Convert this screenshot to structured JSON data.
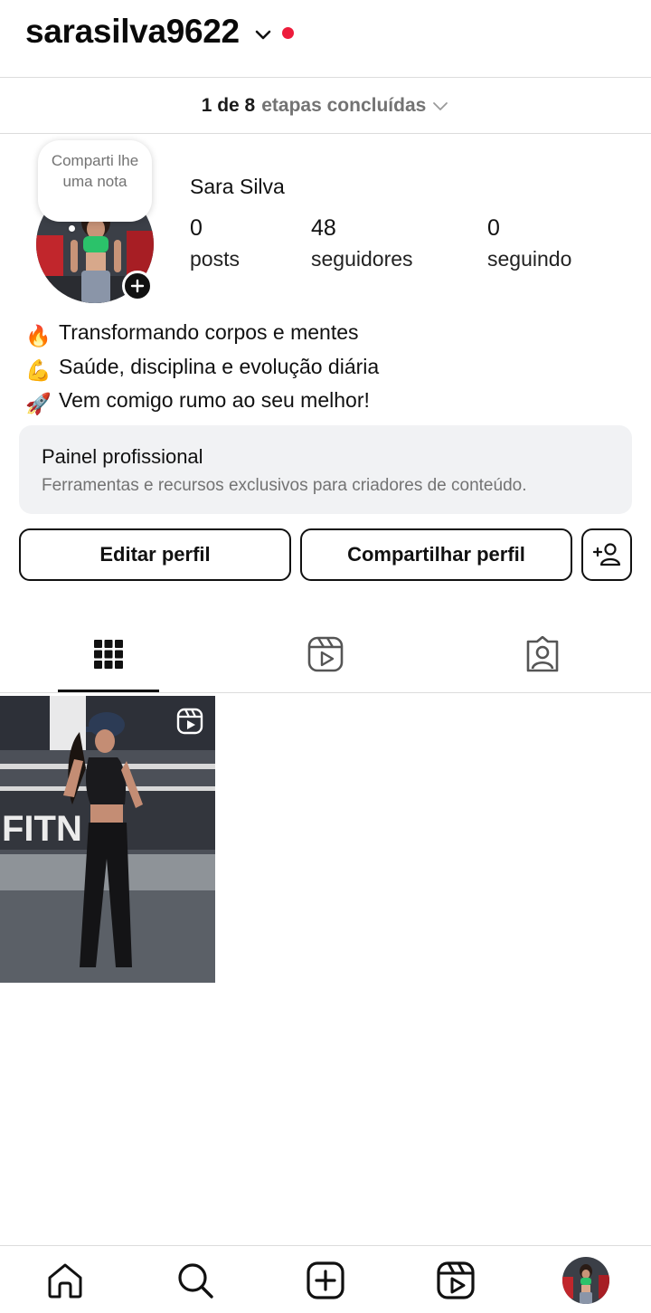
{
  "header": {
    "username": "sarasilva9622",
    "icons": {
      "dropdown": "chevron-down-icon",
      "notification": "notification-dot"
    },
    "notification_color": "#ed1c3b"
  },
  "steps": {
    "count": "1 de 8",
    "label": "etapas concluídas",
    "icon": "chevron-down-icon"
  },
  "profile": {
    "note_text": "Comparti lhe uma nota",
    "full_name": "Sara Silva",
    "stats": [
      {
        "value": "0",
        "label": "posts"
      },
      {
        "value": "48",
        "label": "seguidores"
      },
      {
        "value": "0",
        "label": "seguindo"
      }
    ]
  },
  "bio": [
    {
      "emoji": "🔥",
      "text": "Transformando corpos e mentes"
    },
    {
      "emoji": "💪",
      "text": "Saúde, disciplina e evolução diária"
    },
    {
      "emoji": "🚀",
      "text": "Vem comigo rumo ao seu melhor!"
    }
  ],
  "panel": {
    "title": "Painel profissional",
    "subtitle": "Ferramentas e recursos exclusivos para criadores de conteúdo."
  },
  "actions": {
    "edit_label": "Editar perfil",
    "share_label": "Compartilhar perfil",
    "discover_icon": "add-person-icon"
  },
  "tabs": [
    {
      "name": "grid",
      "icon": "grid-icon",
      "active": true
    },
    {
      "name": "reels",
      "icon": "reels-icon",
      "active": false
    },
    {
      "name": "tagged",
      "icon": "tagged-person-icon",
      "active": false
    }
  ],
  "posts": [
    {
      "type": "reel",
      "icon": "reel-badge-icon"
    }
  ],
  "bottom_nav": [
    {
      "name": "home",
      "icon": "home-icon"
    },
    {
      "name": "search",
      "icon": "search-icon"
    },
    {
      "name": "create",
      "icon": "plus-square-icon"
    },
    {
      "name": "reels",
      "icon": "reels-icon"
    },
    {
      "name": "profile",
      "icon": "profile-avatar"
    }
  ],
  "colors": {
    "accent_text": "#111111",
    "secondary_text": "#737373",
    "panel_bg": "#f1f2f4",
    "divider": "#dcdcdc"
  }
}
